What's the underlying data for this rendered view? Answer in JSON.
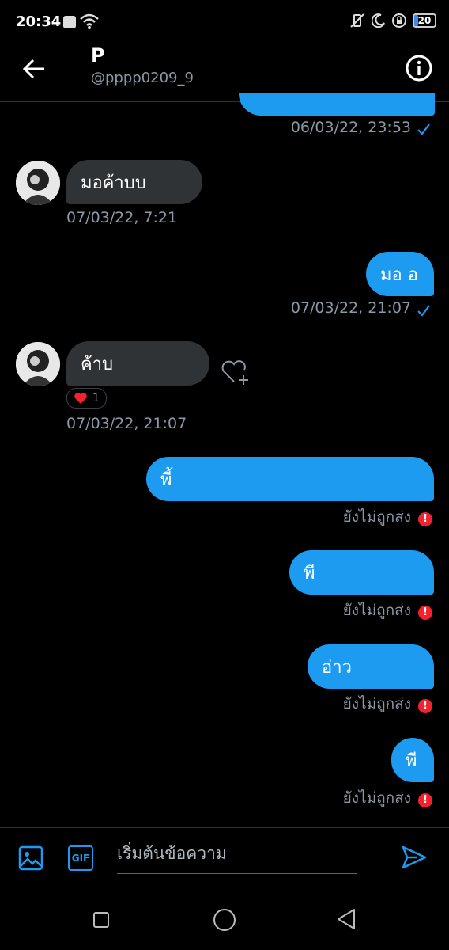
{
  "status_bar": {
    "time": "20:34",
    "battery": "20",
    "battery_level": 0.2
  },
  "header": {
    "name": "P",
    "handle": "@pppp0209_9"
  },
  "messages": [
    {
      "direction": "out",
      "text": "",
      "timestamp": "06/03/22, 23:53",
      "status": "sent"
    },
    {
      "direction": "in",
      "text": "มอค้าบบ",
      "timestamp": "07/03/22, 7:21"
    },
    {
      "direction": "out",
      "text": "มอ อ",
      "timestamp": "07/03/22, 21:07",
      "status": "sent"
    },
    {
      "direction": "in",
      "text": "ค้าบ",
      "timestamp": "07/03/22, 21:07",
      "reaction": {
        "icon": "heart-icon",
        "count": "1"
      }
    },
    {
      "direction": "out",
      "text": "พี้",
      "status_text": "ยังไม่ถูกส่ง",
      "status": "failed"
    },
    {
      "direction": "out",
      "text": "พี",
      "status_text": "ยังไม่ถูกส่ง",
      "status": "failed"
    },
    {
      "direction": "out",
      "text": "อ่าว",
      "status_text": "ยังไม่ถูกส่ง",
      "status": "failed"
    },
    {
      "direction": "out",
      "text": "พี",
      "status_text": "ยังไม่ถูกส่ง",
      "status": "failed"
    }
  ],
  "composer": {
    "placeholder": "เริ่มต้นข้อความ",
    "gif_label": "GIF"
  },
  "colors": {
    "accent": "#1d9bf0",
    "incoming_bubble": "#2f3336",
    "error": "#f4212e",
    "timestamp": "#8b98a5"
  }
}
